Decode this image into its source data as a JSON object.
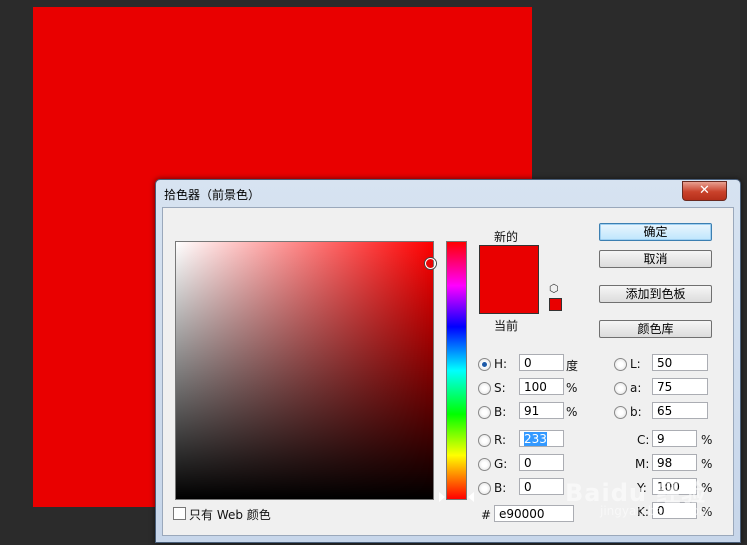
{
  "document": {
    "fill_color": "#e90000"
  },
  "dialog": {
    "title": "拾色器（前景色）",
    "close_glyph": "✕",
    "labels": {
      "new": "新的",
      "current": "当前"
    },
    "buttons": {
      "ok": "确定",
      "cancel": "取消",
      "add_to_swatches": "添加到色板",
      "color_libraries": "颜色库"
    },
    "only_web_colors": "只有 Web 颜色",
    "hsb": {
      "h": {
        "label": "H:",
        "value": "0",
        "unit": "度",
        "selected": true
      },
      "s": {
        "label": "S:",
        "value": "100",
        "unit": "%"
      },
      "b": {
        "label": "B:",
        "value": "91",
        "unit": "%"
      }
    },
    "rgb": {
      "r": {
        "label": "R:",
        "value": "233"
      },
      "g": {
        "label": "G:",
        "value": "0"
      },
      "b": {
        "label": "B:",
        "value": "0"
      }
    },
    "lab": {
      "l": {
        "label": "L:",
        "value": "50"
      },
      "a": {
        "label": "a:",
        "value": "75"
      },
      "b": {
        "label": "b:",
        "value": "65"
      }
    },
    "cmyk": {
      "c": {
        "label": "C:",
        "value": "9",
        "unit": "%"
      },
      "m": {
        "label": "M:",
        "value": "98",
        "unit": "%"
      },
      "y": {
        "label": "Y:",
        "value": "100",
        "unit": "%"
      },
      "k": {
        "label": "K:",
        "value": "0",
        "unit": "%"
      }
    },
    "hex": {
      "label": "#",
      "value": "e90000"
    },
    "colors": {
      "new": "#e90000",
      "current": "#e90000"
    }
  },
  "watermark": {
    "text": "Baidu 经验",
    "sub": "jingyan.baidu.com"
  }
}
